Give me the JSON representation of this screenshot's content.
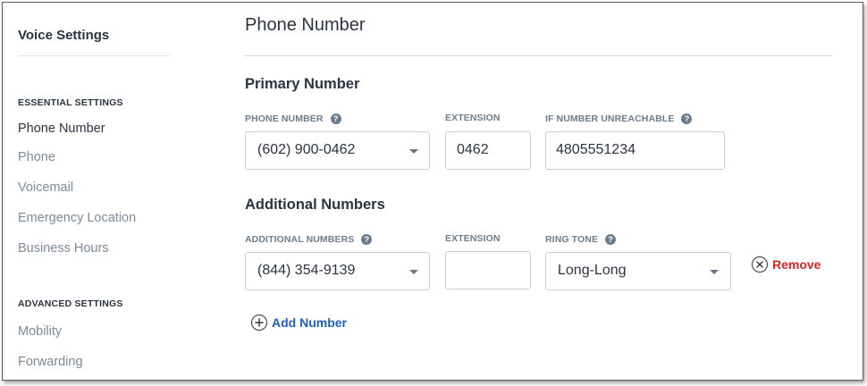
{
  "sidebar": {
    "title": "Voice Settings",
    "essential_heading": "ESSENTIAL SETTINGS",
    "essential_items": [
      {
        "label": "Phone Number"
      },
      {
        "label": "Phone"
      },
      {
        "label": "Voicemail"
      },
      {
        "label": "Emergency Location"
      },
      {
        "label": "Business Hours"
      }
    ],
    "advanced_heading": "ADVANCED SETTINGS",
    "advanced_items": [
      {
        "label": "Mobility"
      },
      {
        "label": "Forwarding"
      }
    ]
  },
  "main": {
    "title": "Phone Number",
    "primary": {
      "heading": "Primary Number",
      "phone_label": "PHONE NUMBER",
      "phone_value": "(602) 900-0462",
      "extension_label": "EXTENSION",
      "extension_value": "0462",
      "unreachable_label": "IF NUMBER UNREACHABLE",
      "unreachable_value": "4805551234"
    },
    "additional": {
      "heading": "Additional Numbers",
      "numbers_label": "ADDITIONAL NUMBERS",
      "number_value": "(844) 354-9139",
      "extension_label": "EXTENSION",
      "extension_value": "",
      "ringtone_label": "RING TONE",
      "ringtone_value": "Long-Long",
      "remove_label": "Remove",
      "add_label": "Add Number"
    }
  },
  "icons": {
    "help": "?",
    "help_icon": "help-circle-icon",
    "remove_icon": "close-circle-icon",
    "add_icon": "plus-circle-icon",
    "caret_icon": "chevron-down-icon"
  },
  "colors": {
    "remove": "#e02424",
    "link": "#1f5fbf",
    "active_nav": "#2b3441",
    "inactive_nav": "#7d8a9a"
  }
}
